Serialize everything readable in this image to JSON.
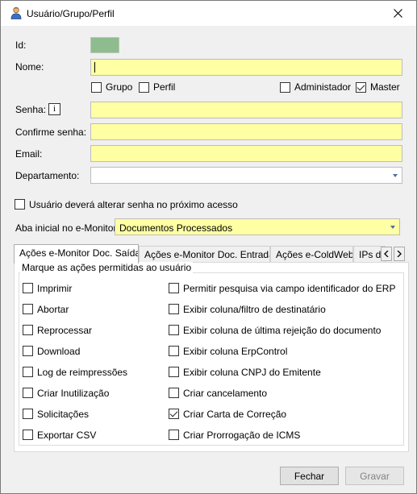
{
  "window": {
    "title": "Usuário/Grupo/Perfil",
    "icon": "user-icon"
  },
  "form": {
    "id_label": "Id:",
    "id_color": "#8fbc8f",
    "nome_label": "Nome:",
    "nome_value": "",
    "grupo_label": "Grupo",
    "grupo_checked": false,
    "perfil_label": "Perfil",
    "perfil_checked": false,
    "admin_label": "Administador",
    "admin_checked": false,
    "master_label": "Master",
    "master_checked": true,
    "senha_label": "Senha:",
    "senha_info_icon": "info-icon",
    "senha_info_glyph": "i",
    "confirme_label": "Confirme senha:",
    "email_label": "Email:",
    "departamento_label": "Departamento:",
    "departamento_value": "",
    "alterar_senha_label": "Usuário deverá alterar senha no próximo acesso",
    "alterar_senha_checked": false,
    "aba_inicial_label": "Aba inicial no e-Monitor:",
    "aba_inicial_value": "Documentos Processados",
    "required_field_color": "#ffffa3"
  },
  "tabs": [
    {
      "label": "Ações e-Monitor Doc. Saída",
      "active": true
    },
    {
      "label": "Ações e-Monitor Doc. Entrada",
      "active": false
    },
    {
      "label": "Ações e-ColdWeb",
      "active": false
    },
    {
      "label": "IPs de",
      "active": false
    }
  ],
  "permissions": {
    "group_title": "Marque as ações permitidas ao usuário",
    "left": [
      {
        "label": "Imprimir",
        "checked": false
      },
      {
        "label": "Abortar",
        "checked": false
      },
      {
        "label": "Reprocessar",
        "checked": false
      },
      {
        "label": "Download",
        "checked": false
      },
      {
        "label": "Log de reimpressões",
        "checked": false
      },
      {
        "label": "Criar Inutilização",
        "checked": false
      },
      {
        "label": "Solicitações",
        "checked": false
      },
      {
        "label": "Exportar CSV",
        "checked": false
      }
    ],
    "right": [
      {
        "label": "Permitir pesquisa via campo identificador do ERP",
        "checked": false
      },
      {
        "label": "Exibir coluna/filtro de destinatário",
        "checked": false
      },
      {
        "label": "Exibir coluna de última rejeição do documento",
        "checked": false
      },
      {
        "label": "Exibir coluna ErpControl",
        "checked": false
      },
      {
        "label": "Exibir coluna CNPJ do Emitente",
        "checked": false
      },
      {
        "label": "Criar cancelamento",
        "checked": false
      },
      {
        "label": "Criar Carta de Correção",
        "checked": true
      },
      {
        "label": "Criar Prorrogação de ICMS",
        "checked": false
      }
    ]
  },
  "buttons": {
    "fechar": "Fechar",
    "gravar": "Gravar",
    "gravar_enabled": false
  }
}
